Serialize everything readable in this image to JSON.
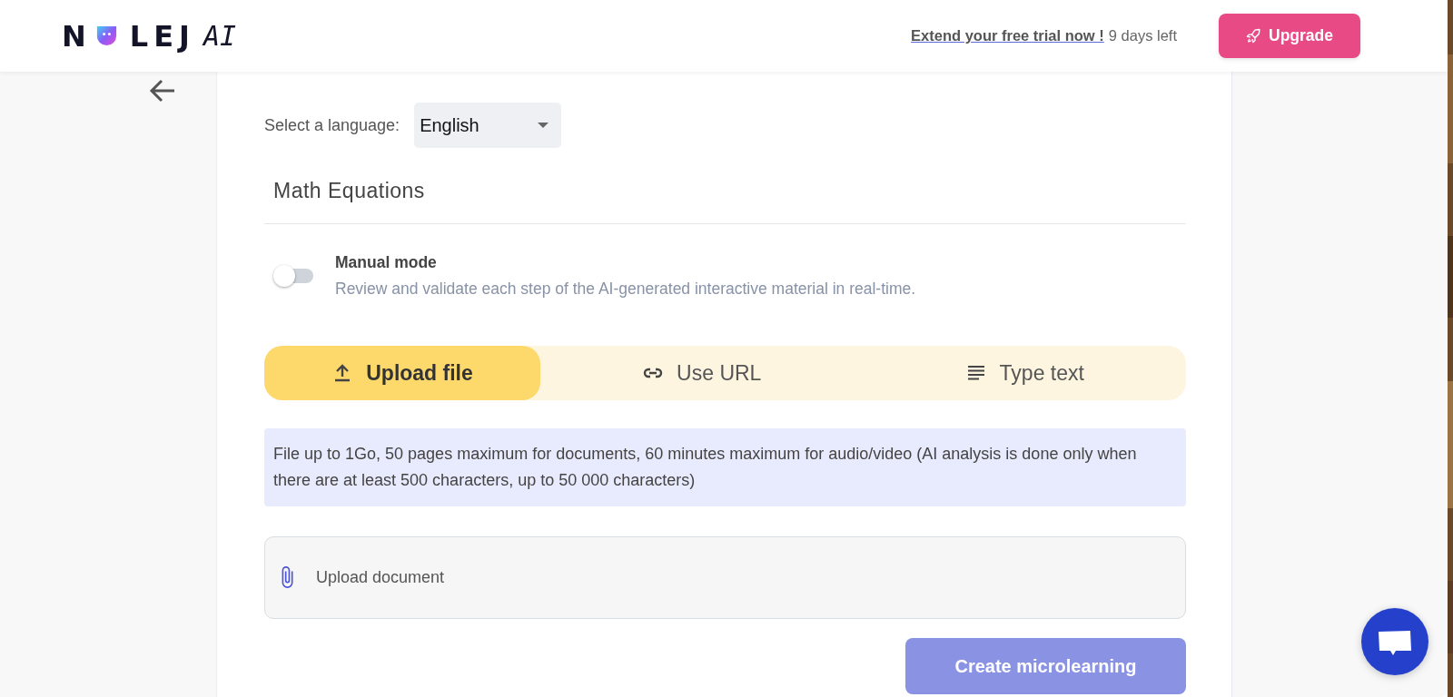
{
  "header": {
    "logo": {
      "before": "N",
      "after": "LEJ",
      "suffix": "AI"
    },
    "trial_link": "Extend your free trial now !",
    "days_left": "9 days left",
    "upgrade_button": "Upgrade"
  },
  "language": {
    "label": "Select a language:",
    "value": "English"
  },
  "section_title": "Math Equations",
  "manual_mode": {
    "title": "Manual mode",
    "description": "Review and validate each step of the AI-generated interactive material in real-time.",
    "on": false
  },
  "source_tabs": [
    {
      "kind": "upload",
      "label": "Upload file",
      "selected": true
    },
    {
      "kind": "url",
      "label": "Use URL",
      "selected": false
    },
    {
      "kind": "text",
      "label": "Type text",
      "selected": false
    }
  ],
  "info": "File up to 1Go, 50 pages maximum for documents, 60 minutes maximum for audio/video (AI analysis is done only when there are at least 500 characters, up to 50 000 characters)",
  "upload_field": {
    "placeholder": "Upload document"
  },
  "create_button": "Create microlearning"
}
